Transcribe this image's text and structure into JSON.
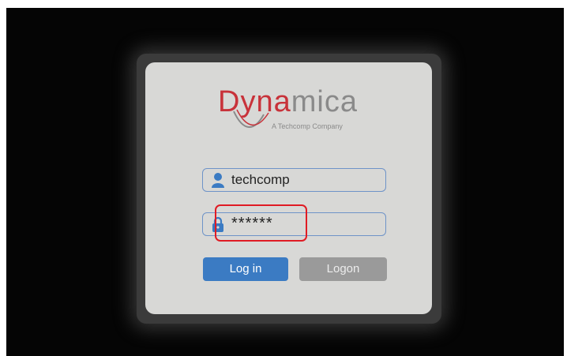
{
  "logo": {
    "brand_part1": "Dyna",
    "brand_part2": "mica",
    "tagline": "A Techcomp Company",
    "brand_color": "#c8323a",
    "secondary_color": "#8a8a8a"
  },
  "form": {
    "username": {
      "value": "techcomp",
      "icon": "user-icon"
    },
    "password": {
      "value": "******",
      "icon": "lock-icon",
      "highlight_color": "#e01b24"
    }
  },
  "buttons": {
    "login_label": "Log in",
    "logon_label": "Logon",
    "login_color": "#3b7bc3",
    "logon_color": "#9a9a9a"
  }
}
